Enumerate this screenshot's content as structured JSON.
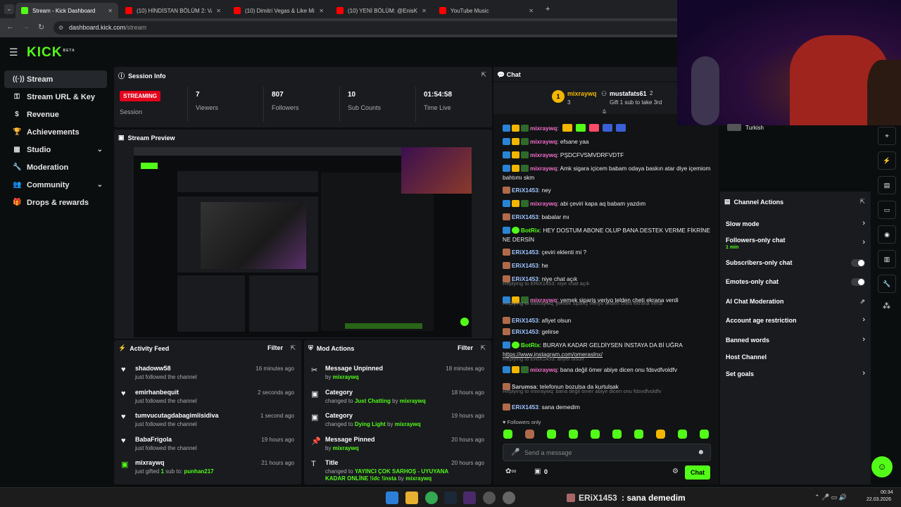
{
  "browser": {
    "tabs": [
      {
        "label": "Stream - Kick Dashboard",
        "color": "#53fc18",
        "active": true
      },
      {
        "label": "(10) HİNDİSTAN BÖLÜM 2: VAR",
        "color": "#ff0000"
      },
      {
        "label": "(10) Dimitri Vegas & Like Mike",
        "color": "#ff0000"
      },
      {
        "label": "(10) YENİ BÖLÜM: @EnisKirazo",
        "color": "#ff0000"
      },
      {
        "label": "YouTube Music",
        "color": "#ff0000"
      }
    ],
    "url_host": "dashboard.kick.com",
    "url_path": "/stream"
  },
  "logo": {
    "text": "KICK",
    "beta": "BETA"
  },
  "sidebar": {
    "items": [
      {
        "label": "Stream",
        "icon": "broadcast-icon",
        "glyph": "((·))",
        "active": true
      },
      {
        "label": "Stream URL & Key",
        "icon": "key-icon",
        "glyph": "⚿"
      },
      {
        "label": "Revenue",
        "icon": "dollar-icon",
        "glyph": "$"
      },
      {
        "label": "Achievements",
        "icon": "trophy-icon",
        "glyph": "🏆"
      },
      {
        "label": "Studio",
        "icon": "studio-icon",
        "glyph": "▦",
        "expandable": true
      },
      {
        "label": "Moderation",
        "icon": "wrench-icon",
        "glyph": "🔧"
      },
      {
        "label": "Community",
        "icon": "people-icon",
        "glyph": "👥",
        "expandable": true
      },
      {
        "label": "Drops & rewards",
        "icon": "gift-icon",
        "glyph": "🎁"
      }
    ]
  },
  "session": {
    "title": "Session Info",
    "badge": "STREAMING",
    "badge_label": "Session",
    "stats": [
      {
        "value": "7",
        "label": "Viewers"
      },
      {
        "value": "807",
        "label": "Followers"
      },
      {
        "value": "10",
        "label": "Sub Counts"
      },
      {
        "value": "01:54:58",
        "label": "Time Live"
      }
    ]
  },
  "preview": {
    "title": "Stream Preview"
  },
  "activity": {
    "title": "Activity Feed",
    "filter": "Filter",
    "items": [
      {
        "name": "shadoww58",
        "sub": "just followed the channel",
        "time": "16 minutes ago",
        "icon": "heart-icon",
        "glyph": "♥"
      },
      {
        "name": "emirhanbequit",
        "sub": "just followed the channel",
        "time": "2 seconds ago",
        "icon": "heart-icon",
        "glyph": "♥"
      },
      {
        "name": "tumvucutagdabagimlisidiva",
        "sub": "just followed the channel",
        "time": "1 second ago",
        "icon": "heart-icon",
        "glyph": "♥"
      },
      {
        "name": "BabaFrigola",
        "sub": "just followed the channel",
        "time": "19 hours ago",
        "icon": "heart-icon",
        "glyph": "♥"
      },
      {
        "name": "mixraywq",
        "sub_pre": "just gifted ",
        "sub_num": "1",
        "sub_mid": " sub to: ",
        "sub_target": "punhan217",
        "time": "21 hours ago",
        "icon": "gift-icon",
        "glyph": "▣"
      }
    ]
  },
  "mod": {
    "title": "Mod Actions",
    "filter": "Filter",
    "items": [
      {
        "title": "Message Unpinned",
        "pre": "by ",
        "hl": "mixraywq",
        "post": "",
        "time": "18 minutes ago",
        "icon": "unpin-icon",
        "glyph": "✂"
      },
      {
        "title": "Category",
        "pre": "changed to ",
        "hl": "Just Chatting",
        "post": " by ",
        "hl2": "mixraywq",
        "time": "18 hours ago",
        "icon": "category-icon",
        "glyph": "▣"
      },
      {
        "title": "Category",
        "pre": "changed to ",
        "hl": "Dying Light",
        "post": " by ",
        "hl2": "mixraywq",
        "time": "19 hours ago",
        "icon": "category-icon",
        "glyph": "▣"
      },
      {
        "title": "Message Pinned",
        "pre": "by ",
        "hl": "mixraywq",
        "post": "",
        "time": "20 hours ago",
        "icon": "pin-icon",
        "glyph": "📌"
      },
      {
        "title": "Title",
        "pre": "changed to ",
        "hl": "YAYINCI ÇOK SARHOŞ - UYUYANA KADAR ONLİNE !idc !insta",
        "post": " by ",
        "hl2": "mixraywq",
        "time": "20 hours ago",
        "icon": "title-icon",
        "glyph": "T"
      }
    ]
  },
  "chat": {
    "title": "Chat",
    "leader1": {
      "rank": "1",
      "name": "mixraywq",
      "count": "3"
    },
    "leader2": {
      "name": "mustafats61",
      "count": "2",
      "sub": "Gift 1 sub to take 3rd"
    },
    "messages": [
      {
        "user": "mixraywq",
        "color": "#f06ec8",
        "text": "",
        "emotes": true
      },
      {
        "user": "mixraywq",
        "color": "#f06ec8",
        "text": "efsane yaa"
      },
      {
        "user": "mixraywq",
        "color": "#f06ec8",
        "text": "PŞDCFVSMVDRFVDTF"
      },
      {
        "user": "mixraywq",
        "color": "#f06ec8",
        "text": "Amk sigara içicem babam odaya baskın atar diye içemiom bahtımı skm"
      },
      {
        "user": "ERiX1453",
        "color": "#a0c4ff",
        "text": "ney"
      },
      {
        "user": "mixraywq",
        "color": "#f06ec8",
        "text": "abi çeviri kapa aq babam yazdım"
      },
      {
        "user": "ERiX1453",
        "color": "#a0c4ff",
        "text": "babalar mı"
      },
      {
        "user": "BotRix",
        "color": "#53fc18",
        "text": "HEY DOSTUM ABONE OLUP BANA DESTEK VERME FİKRİNE NE DERSİN"
      },
      {
        "user": "ERiX1453",
        "color": "#a0c4ff",
        "text": "çeviri eklenti mi ?"
      },
      {
        "user": "ERiX1453",
        "color": "#a0c4ff",
        "text": "he"
      },
      {
        "user": "ERiX1453",
        "color": "#a0c4ff",
        "text": "niye chat açık"
      },
      {
        "reply": "Replying to ERiX1453: niye chat açık",
        "user": "mixraywq",
        "color": "#f06ec8",
        "text": "yemek sipariş veriyo telden cheti ekrana verdi"
      },
      {
        "reply": "Replying to mixraywq: yemek sipariş veriyo telden cheti ekrana verdi",
        "user": "ERiX1453",
        "color": "#a0c4ff",
        "text": "afiyet olsun"
      },
      {
        "user": "ERiX1453",
        "color": "#a0c4ff",
        "text": "gelirse"
      },
      {
        "user": "BotRix",
        "color": "#53fc18",
        "text": "BURAYA KADAR GELDİYSEN İNSTAYA DA Bİ UĞRA",
        "link": "https://www.instagram.com/omeraslnx/"
      },
      {
        "reply": "Replying to ERiX1453: afiyet olsun",
        "user": "mixraywq",
        "color": "#f06ec8",
        "text": "bana değil ömer abiye dicen onu fdsvdfvoldfv"
      },
      {
        "user": "Sarumsa",
        "color": "#d0d0d0",
        "text": "telefonun bozulsa da kurtulsak"
      },
      {
        "reply": "Replying to mixraywq: bana değil ömer abiye dicen onu fdsvdfvoldfv",
        "user": "ERiX1453",
        "color": "#a0c4ff",
        "text": "sana demedim"
      }
    ],
    "followers_only": "Followers only",
    "placeholder": "Send a message",
    "count": "0",
    "send": "Chat"
  },
  "channel_actions": {
    "title": "Channel Actions",
    "language_tag": "Turkish",
    "items": [
      {
        "label": "Slow mode",
        "kind": "arrow"
      },
      {
        "label": "Followers-only chat",
        "sub": "1 min",
        "kind": "arrow"
      },
      {
        "label": "Subscribers-only chat",
        "kind": "toggle"
      },
      {
        "label": "Emotes-only chat",
        "kind": "toggle"
      },
      {
        "label": "AI Chat Moderation",
        "kind": "chart"
      },
      {
        "label": "Account age restriction",
        "kind": "arrow"
      },
      {
        "label": "Banned words",
        "kind": "arrow"
      },
      {
        "label": "Host Channel",
        "kind": "none"
      },
      {
        "label": "Set goals",
        "kind": "arrow"
      }
    ]
  },
  "taskbar": {
    "now_playing_user": "ERiX1453",
    "now_playing_text": ": sana demedim",
    "time": "00:34",
    "date": "22.03.2026"
  },
  "colors": {
    "accent": "#53fc18",
    "streaming": "#e2001a",
    "panel": "#191b1f"
  }
}
